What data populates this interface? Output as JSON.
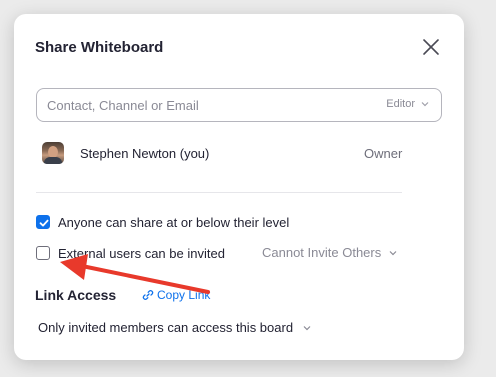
{
  "dialog": {
    "title": "Share Whiteboard"
  },
  "invite": {
    "placeholder": "Contact, Channel or Email",
    "role_label": "Editor"
  },
  "members": [
    {
      "name": "Stephen Newton (you)",
      "role": "Owner"
    }
  ],
  "permissions": {
    "anyone_share": {
      "label": "Anyone can share at or below their level",
      "checked": true
    },
    "external_invite": {
      "label": "External users can be invited",
      "checked": false
    },
    "invite_setting": "Cannot Invite Others"
  },
  "link_access": {
    "heading": "Link Access",
    "copy_label": "Copy Link",
    "access_value": "Only invited members can access this board"
  },
  "colors": {
    "accent": "#0e71eb",
    "annotation_arrow": "#e8392b"
  },
  "icons": {
    "close": "close-icon",
    "chevron": "chevron-down-icon",
    "link": "link-icon",
    "check": "check-icon"
  }
}
